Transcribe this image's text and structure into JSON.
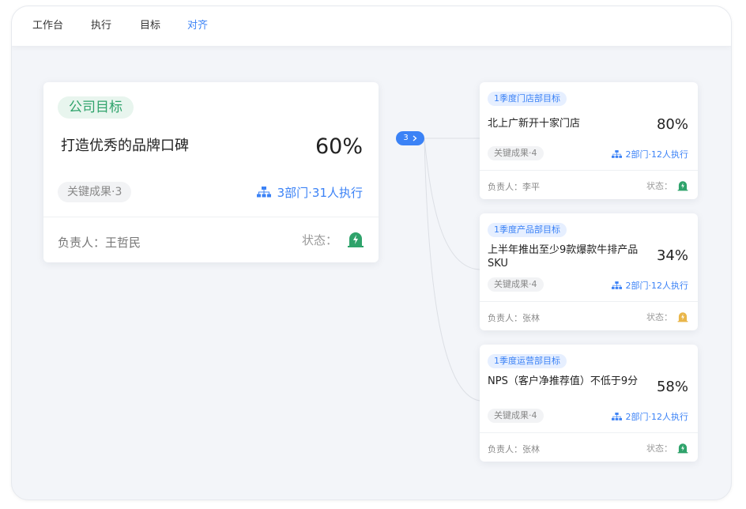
{
  "nav": {
    "tabs": [
      {
        "label": "工作台"
      },
      {
        "label": "执行"
      },
      {
        "label": "目标"
      },
      {
        "label": "对齐"
      }
    ],
    "active_index": 3
  },
  "main_goal": {
    "tag": "公司目标",
    "title": "打造优秀的品牌口碑",
    "progress": "60%",
    "key_results": "关键成果·3",
    "execution": "3部门·31人执行",
    "owner": "负责人：王哲民",
    "status_label": "状态："
  },
  "expand_badge": {
    "count": "3",
    "icon": "chevron-right-icon"
  },
  "sub_goals": [
    {
      "tag": "1季度门店部目标",
      "title": "北上广新开十家门店",
      "progress": "80%",
      "key_results": "关键成果·4",
      "execution": "2部门·12人执行",
      "owner": "负责人：李平",
      "status_label": "状态：",
      "status_color": "#2fa36b"
    },
    {
      "tag": "1季度产品部目标",
      "title": "上半年推出至少9款爆款牛排产品SKU",
      "progress": "34%",
      "key_results": "关键成果·4",
      "execution": "2部门·12人执行",
      "owner": "负责人：张林",
      "status_label": "状态：",
      "status_color": "#e9b64a"
    },
    {
      "tag": "1季度运营部目标",
      "title": "NPS（客户净推荐值）不低于9分",
      "progress": "58%",
      "key_results": "关键成果·4",
      "execution": "2部门·12人执行",
      "owner": "负责人：张林",
      "status_label": "状态：",
      "status_color": "#2fa36b"
    }
  ],
  "colors": {
    "accent": "#3b82f6",
    "company_tag": "#2fa36b",
    "status_ok": "#2fa36b",
    "status_warn": "#e9b64a"
  }
}
